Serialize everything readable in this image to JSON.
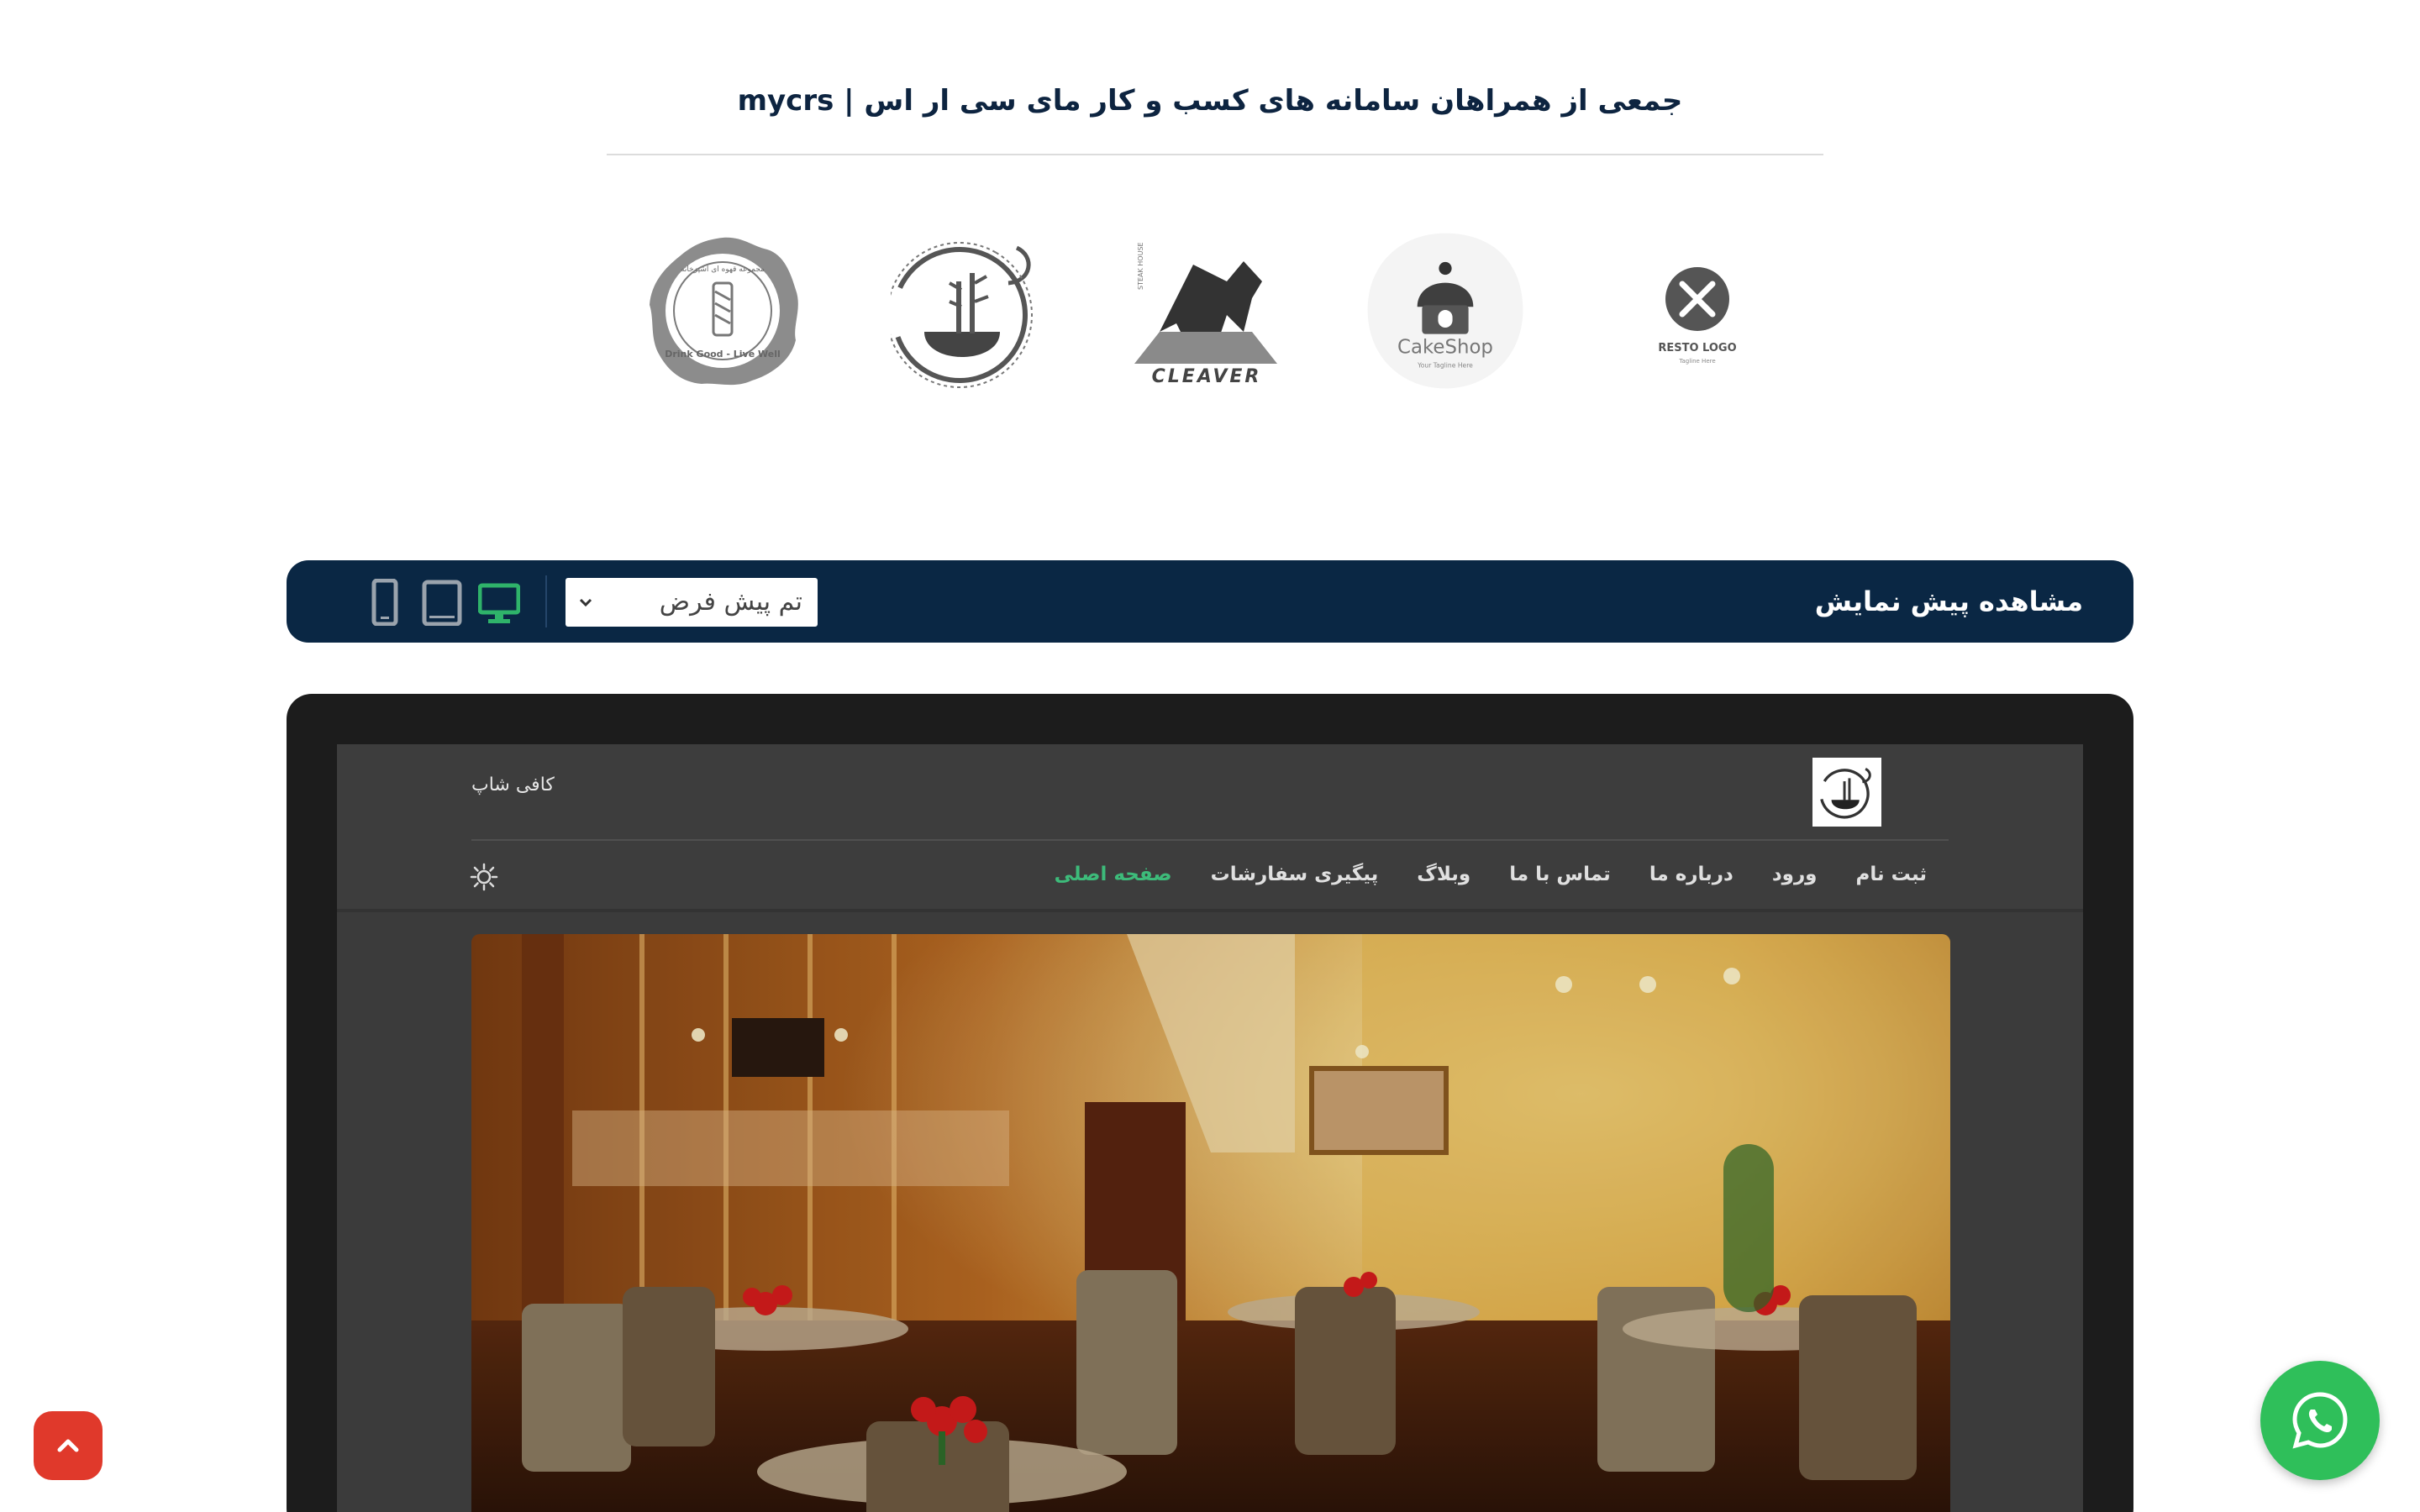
{
  "partners": {
    "title": "جمعی از همراهان سامانه های کسب و کار مای سی ار اس | mycrs",
    "logos": [
      {
        "name": "drink-good-live-well-logo",
        "text": "Drink Good - Live Well",
        "arc_text": "مجموعه قهوه ای آشپزخانه"
      },
      {
        "name": "bamboo-bowl-logo"
      },
      {
        "name": "cleaver-steakhouse-logo",
        "text": "CLEAVER",
        "sub": "STEAK HOUSE"
      },
      {
        "name": "cakeshop-logo",
        "text": "CakeShop",
        "sub": "Your Tagline Here"
      },
      {
        "name": "resto-logo",
        "text": "RESTO LOGO",
        "sub": "Tagline Here"
      }
    ]
  },
  "preview": {
    "title": "مشاهده پیش نمایش",
    "theme_select_value": "تم پیش فرض",
    "devices": [
      {
        "name": "desktop",
        "icon": "desktop-icon",
        "active": true
      },
      {
        "name": "tablet",
        "icon": "tablet-icon",
        "active": false
      },
      {
        "name": "mobile",
        "icon": "mobile-icon",
        "active": false
      }
    ],
    "accent_color": "#2fb36a"
  },
  "site": {
    "name": "کافی شاپ",
    "nav": [
      "صفحه اصلی",
      "پیگیری سفارشات",
      "وبلاگ",
      "تماس با ما",
      "درباره ما",
      "ورود",
      "ثبت نام"
    ],
    "active_nav": "صفحه اصلی",
    "accent_color": "#3dbb7a"
  },
  "floating": {
    "whatsapp_icon": "whatsapp-icon",
    "scroll_top_icon": "chevron-up-icon",
    "whatsapp_color": "#2fbf5a",
    "scroll_top_color": "#e0392b"
  }
}
